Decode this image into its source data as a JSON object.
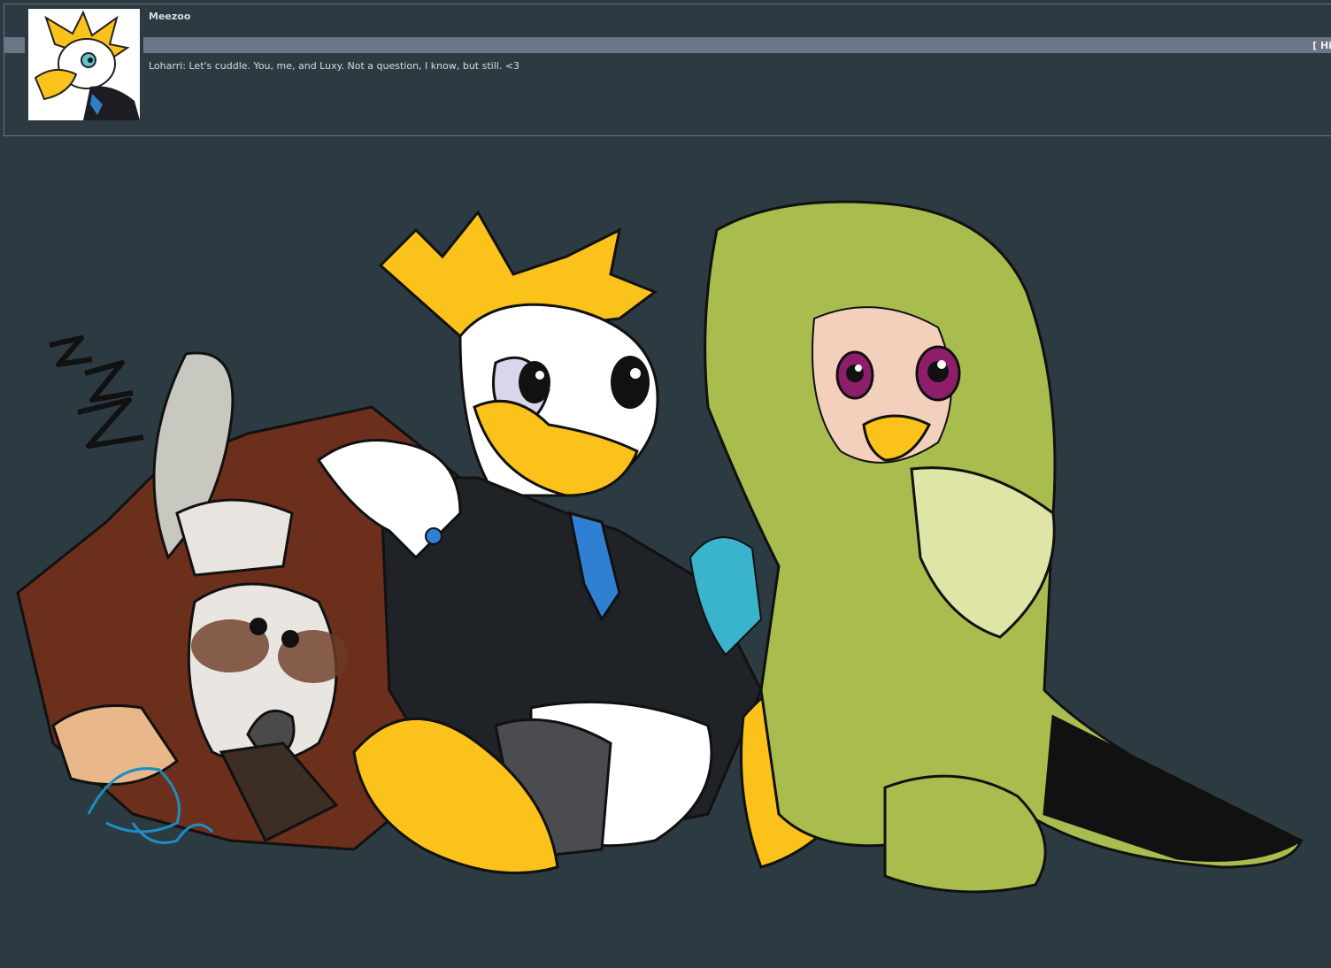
{
  "post": {
    "username": "Meezoo",
    "hide_label": "[ Hi",
    "message": "Loharri: Let's cuddle. You, me, and Luxy. Not a question, I know, but still. <3"
  },
  "colors": {
    "background": "#2c3a42",
    "bar": "#6c7686",
    "text": "#d6dbe0",
    "yellow": "#fbc21c",
    "green": "#a9bd4e",
    "brown": "#6b2f1c"
  }
}
